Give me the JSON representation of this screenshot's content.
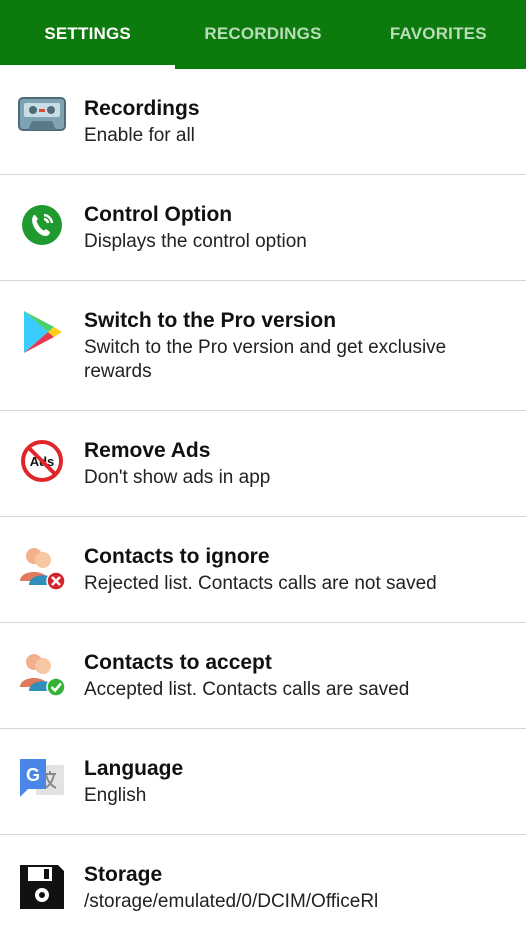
{
  "tabs": [
    {
      "label": "SETTINGS",
      "active": true
    },
    {
      "label": "RECORDINGS",
      "active": false
    },
    {
      "label": "FAVORITES",
      "active": false
    }
  ],
  "colors": {
    "toolbar": "#0d7a0d",
    "tab_inactive": "#b9dcb9",
    "divider": "#d6d6d6"
  },
  "settings": [
    {
      "title": "Recordings",
      "subtitle": "Enable for all",
      "icon": "cassette-icon"
    },
    {
      "title": "Control Option",
      "subtitle": "Displays the control option",
      "icon": "phone-call-icon"
    },
    {
      "title": "Switch to the Pro version",
      "subtitle": "Switch to the Pro version and get exclusive rewards",
      "icon": "play-store-icon"
    },
    {
      "title": "Remove Ads",
      "subtitle": "Don't show ads in app",
      "icon": "no-ads-icon",
      "icon_text": "Ads"
    },
    {
      "title": "Contacts to ignore",
      "subtitle": "Rejected list. Contacts calls are not saved",
      "icon": "contacts-ignore-icon"
    },
    {
      "title": "Contacts to accept",
      "subtitle": "Accepted list. Contacts calls are saved",
      "icon": "contacts-accept-icon"
    },
    {
      "title": "Language",
      "subtitle": "English",
      "icon": "translate-icon"
    },
    {
      "title": "Storage",
      "subtitle": "/storage/emulated/0/DCIM/OfficeRl",
      "icon": "floppy-disk-icon"
    }
  ]
}
